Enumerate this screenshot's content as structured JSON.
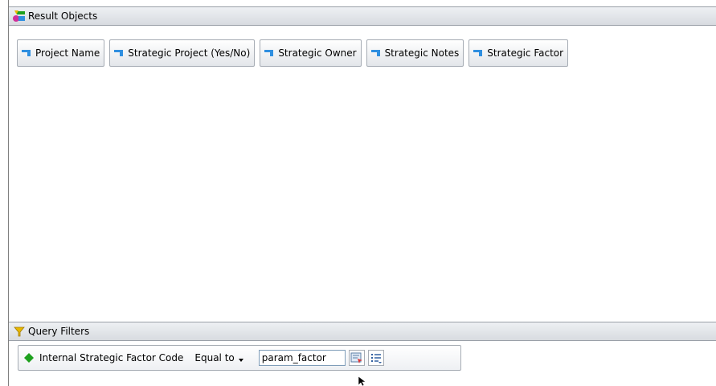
{
  "result_objects": {
    "title": "Result Objects",
    "header_icon": "result-objects-icon",
    "items": [
      {
        "label": "Project Name",
        "icon": "dimension-icon"
      },
      {
        "label": "Strategic Project (Yes/No)",
        "icon": "dimension-icon"
      },
      {
        "label": "Strategic Owner",
        "icon": "dimension-icon"
      },
      {
        "label": "Strategic Notes",
        "icon": "dimension-icon"
      },
      {
        "label": "Strategic Factor",
        "icon": "dimension-icon"
      }
    ]
  },
  "query_filters": {
    "title": "Query Filters",
    "header_icon": "funnel-icon",
    "filter": {
      "object": "Internal Strategic Factor Code",
      "object_icon": "filter-object-icon",
      "operator": "Equal to",
      "operand_value": "param_factor"
    }
  },
  "colors": {
    "dimension_blue": "#2f8fe0",
    "filter_green": "#1ea01e",
    "funnel_yellow": "#e8b800"
  }
}
